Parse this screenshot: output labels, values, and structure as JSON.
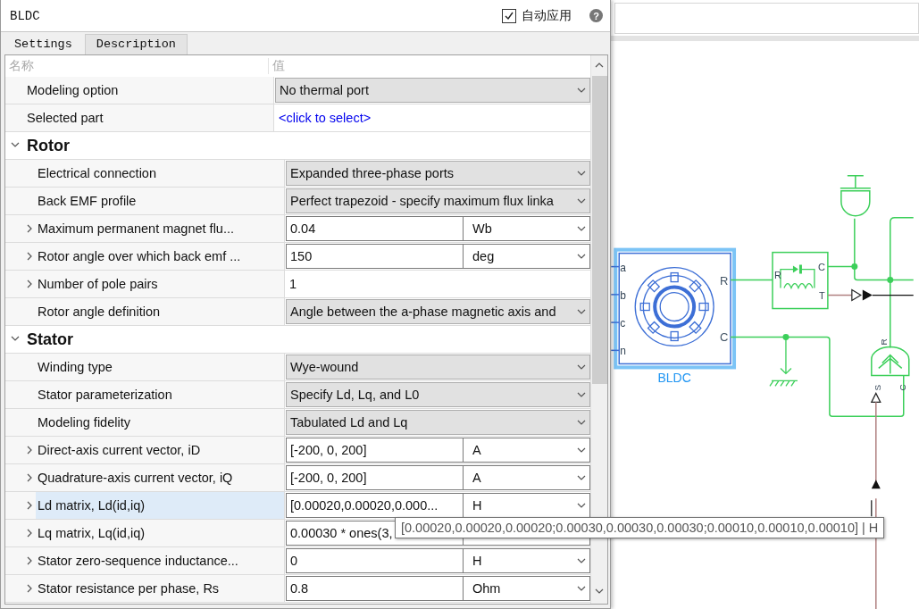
{
  "window": {
    "title": "BLDC",
    "auto_apply": {
      "label": "自动应用",
      "checked": true
    },
    "help": "?"
  },
  "tabs": [
    {
      "label": "Settings",
      "selected": true
    },
    {
      "label": "Description",
      "selected": false
    }
  ],
  "table": {
    "columns": [
      "名称",
      "值"
    ],
    "rows": [
      {
        "kind": "dropdown",
        "label": "Modeling option",
        "value": "No thermal port",
        "expandable": false,
        "selected": false
      },
      {
        "kind": "link",
        "label": "Selected part",
        "value": "<click to select>",
        "expandable": false,
        "selected": false
      },
      {
        "kind": "section",
        "label": "Rotor",
        "expanded": true,
        "children": [
          {
            "kind": "dropdown",
            "label": "Electrical connection",
            "value": "Expanded three-phase ports",
            "expandable": false,
            "selected": false
          },
          {
            "kind": "dropdown",
            "label": "Back EMF profile",
            "value": "Perfect trapezoid - specify maximum flux linka",
            "expandable": false,
            "selected": false
          },
          {
            "kind": "value_unit",
            "label": "Maximum permanent magnet flu...",
            "value": "0.04",
            "unit": "Wb",
            "expandable": true,
            "selected": false
          },
          {
            "kind": "value_unit",
            "label": "Rotor angle over which back emf ...",
            "value": "150",
            "unit": "deg",
            "expandable": true,
            "selected": false
          },
          {
            "kind": "text",
            "label": "Number of pole pairs",
            "value": "1",
            "expandable": true,
            "selected": false
          },
          {
            "kind": "dropdown",
            "label": "Rotor angle definition",
            "value": "Angle between the a-phase magnetic axis and",
            "expandable": false,
            "selected": false
          }
        ]
      },
      {
        "kind": "section",
        "label": "Stator",
        "expanded": true,
        "children": [
          {
            "kind": "dropdown",
            "label": "Winding type",
            "value": "Wye-wound",
            "expandable": false,
            "selected": false
          },
          {
            "kind": "dropdown",
            "label": "Stator parameterization",
            "value": "Specify Ld, Lq, and L0",
            "expandable": false,
            "selected": false
          },
          {
            "kind": "dropdown",
            "label": "Modeling fidelity",
            "value": "Tabulated Ld and Lq",
            "expandable": false,
            "selected": false
          },
          {
            "kind": "value_unit",
            "label": "Direct-axis current vector, iD",
            "value": "[-200, 0, 200]",
            "unit": "A",
            "expandable": true,
            "selected": false
          },
          {
            "kind": "value_unit",
            "label": "Quadrature-axis current vector, iQ",
            "value": "[-200, 0, 200]",
            "unit": "A",
            "expandable": true,
            "selected": false
          },
          {
            "kind": "value_unit",
            "label": "Ld matrix, Ld(id,iq)",
            "value": "[0.00020,0.00020,0.000...",
            "unit": "H",
            "expandable": true,
            "selected": true
          },
          {
            "kind": "value_unit",
            "label": "Lq matrix, Lq(id,iq)",
            "value": "0.00030 * ones(3,",
            "expandable": true,
            "selected": false
          },
          {
            "kind": "value_unit",
            "label": "Stator zero-sequence inductance...",
            "value": "0",
            "unit": "H",
            "expandable": true,
            "selected": false
          },
          {
            "kind": "value_unit",
            "label": "Stator resistance per phase, Rs",
            "value": "0.8",
            "unit": "Ohm",
            "expandable": true,
            "selected": false
          }
        ]
      }
    ]
  },
  "tooltip": "[0.00020,0.00020,0.00020;0.00030,0.00030,0.00030;0.00010,0.00010,0.00010] | H",
  "diagram": {
    "block_label": "BLDC",
    "ports_left": [
      "a",
      "b",
      "c",
      "n"
    ],
    "ports_right": [
      "R",
      "C"
    ],
    "sensor_ports": [
      "R",
      "C",
      "T"
    ],
    "source_ports": [
      "R",
      "S",
      "C"
    ]
  }
}
